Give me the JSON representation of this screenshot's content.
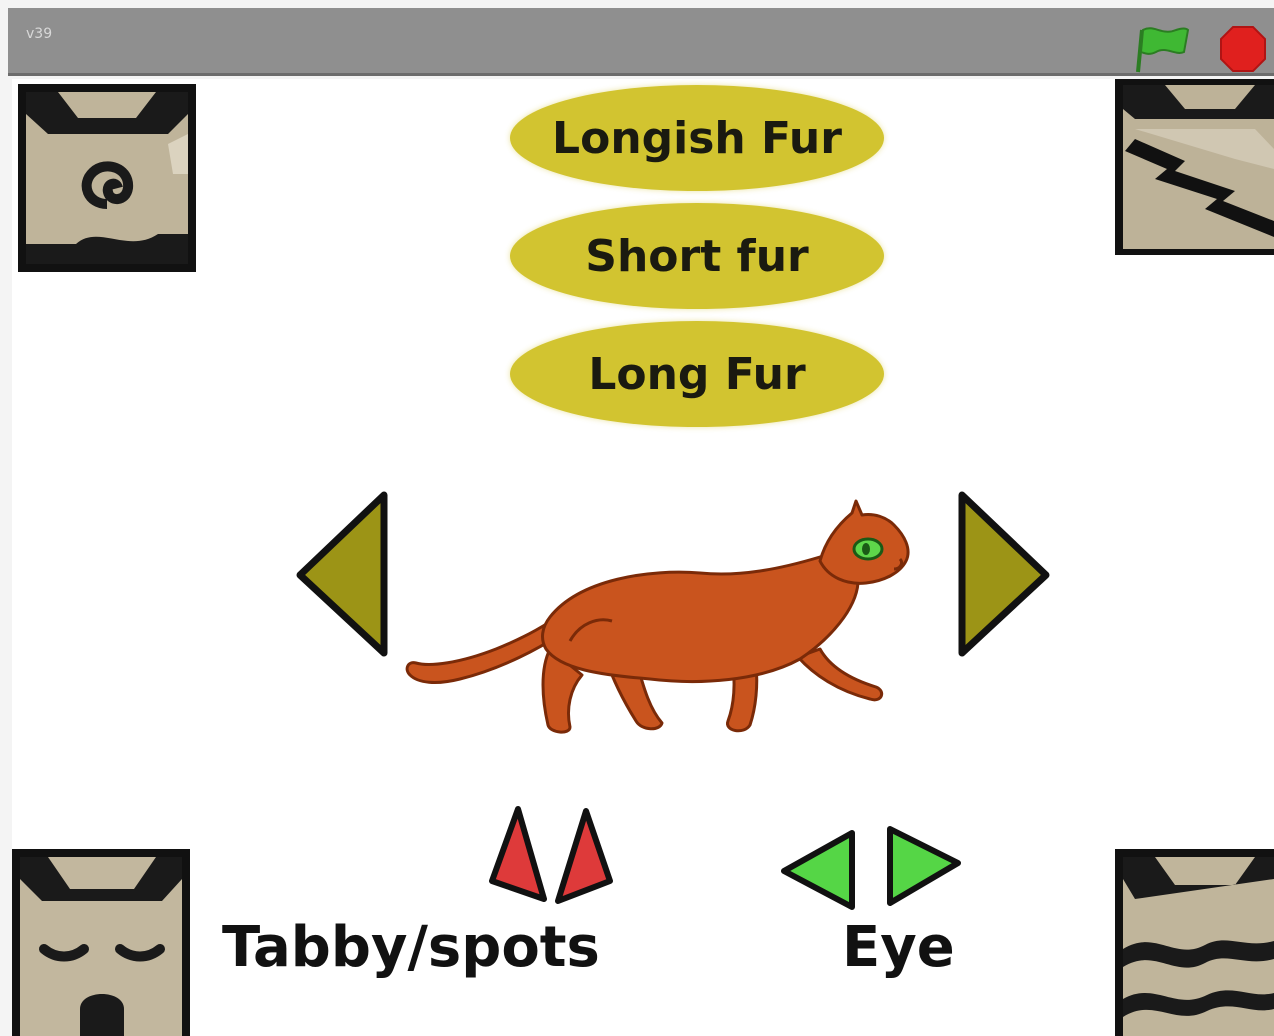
{
  "window": {
    "title": "v39"
  },
  "toolbar": {
    "green_flag_icon": "green-flag-icon",
    "stop_icon": "stop-sign-icon",
    "flag_color": "#35a82c",
    "stop_color": "#e0201e"
  },
  "fur_options": [
    {
      "label": "Longish Fur"
    },
    {
      "label": "Short fur"
    },
    {
      "label": "Long Fur"
    }
  ],
  "cat": {
    "fur_color": "#c9541e",
    "eye_color": "#5ed64a"
  },
  "controls": {
    "tabby_label": "Tabby/spots",
    "eye_label": "Eye",
    "main_arrow_color": "#9c9416",
    "tabby_arrow_color": "#de3a3a",
    "eye_arrow_color": "#55d646"
  },
  "corner_tiles": [
    {
      "name": "swirl-clan-symbol"
    },
    {
      "name": "lightning-clan-symbol"
    },
    {
      "name": "sleeping-face-clan-symbol"
    },
    {
      "name": "wave-clan-symbol"
    }
  ]
}
